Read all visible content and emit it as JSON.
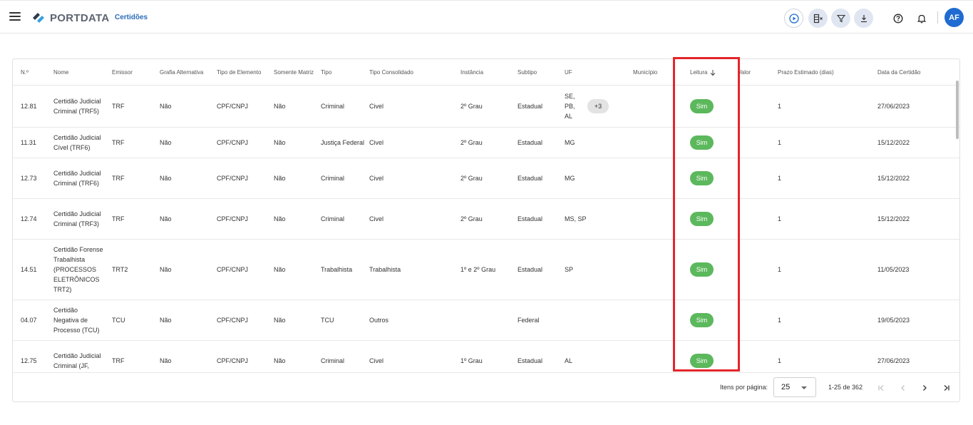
{
  "header": {
    "brand": "PORTDATA",
    "page_link": "Certidões",
    "avatar_initials": "AF",
    "brand_colors": {
      "primary": "#1f6bd1",
      "logo_dark": "#2b3a4a",
      "logo_light": "#3aa0e0"
    }
  },
  "toolbar_icons": [
    "play-circle-icon",
    "columns-clear-icon",
    "filter-icon",
    "download-icon",
    "help-icon",
    "bell-icon"
  ],
  "table": {
    "columns": [
      {
        "key": "num",
        "label": "N.º"
      },
      {
        "key": "nome",
        "label": "Nome"
      },
      {
        "key": "emissor",
        "label": "Emissor"
      },
      {
        "key": "grafia",
        "label": "Grafia Alternativa"
      },
      {
        "key": "tipo_elemento",
        "label": "Tipo de Elemento"
      },
      {
        "key": "somente_matriz",
        "label": "Somente Matriz"
      },
      {
        "key": "tipo",
        "label": "Tipo"
      },
      {
        "key": "tipo_consolidado",
        "label": "Tipo Consolidado"
      },
      {
        "key": "instancia",
        "label": "Instância"
      },
      {
        "key": "subtipo",
        "label": "Subtipo"
      },
      {
        "key": "uf",
        "label": "UF"
      },
      {
        "key": "municipio",
        "label": "Município"
      },
      {
        "key": "leitura",
        "label": "Leitura"
      },
      {
        "key": "valor",
        "label": "Valor"
      },
      {
        "key": "prazo",
        "label": "Prazo Estimado (dias)"
      },
      {
        "key": "data",
        "label": "Data da Certidão"
      }
    ],
    "sort": {
      "column": "Leitura",
      "direction": "desc"
    },
    "rows": [
      {
        "num": "12.81",
        "nome": "Certidão Judicial Criminal (TRF5)",
        "emissor": "TRF",
        "grafia": "Não",
        "tipo_elemento": "CPF/CNPJ",
        "somente_matriz": "Não",
        "tipo": "Criminal",
        "tipo_consolidado": "Civel",
        "instancia": "2º Grau",
        "subtipo": "Estadual",
        "uf": "SE, PB, AL",
        "uf_more": "+3",
        "municipio": "",
        "leitura": "Sim",
        "valor": "",
        "prazo": "1",
        "data": "27/06/2023"
      },
      {
        "num": "11.31",
        "nome": "Certidão Judicial Cível (TRF6)",
        "emissor": "TRF",
        "grafia": "Não",
        "tipo_elemento": "CPF/CNPJ",
        "somente_matriz": "Não",
        "tipo": "Justiça Federal",
        "tipo_consolidado": "Civel",
        "instancia": "2º Grau",
        "subtipo": "Estadual",
        "uf": "MG",
        "uf_more": "",
        "municipio": "",
        "leitura": "Sim",
        "valor": "",
        "prazo": "1",
        "data": "15/12/2022"
      },
      {
        "num": "12.73",
        "nome": "Certidão Judicial Criminal (TRF6)",
        "emissor": "TRF",
        "grafia": "Não",
        "tipo_elemento": "CPF/CNPJ",
        "somente_matriz": "Não",
        "tipo": "Criminal",
        "tipo_consolidado": "Civel",
        "instancia": "2º Grau",
        "subtipo": "Estadual",
        "uf": "MG",
        "uf_more": "",
        "municipio": "",
        "leitura": "Sim",
        "valor": "",
        "prazo": "1",
        "data": "15/12/2022"
      },
      {
        "num": "12.74",
        "nome": "Certidão Judicial Criminal (TRF3)",
        "emissor": "TRF",
        "grafia": "Não",
        "tipo_elemento": "CPF/CNPJ",
        "somente_matriz": "Não",
        "tipo": "Criminal",
        "tipo_consolidado": "Civel",
        "instancia": "2º Grau",
        "subtipo": "Estadual",
        "uf": "MS, SP",
        "uf_more": "",
        "municipio": "",
        "leitura": "Sim",
        "valor": "",
        "prazo": "1",
        "data": "15/12/2022"
      },
      {
        "num": "14.51",
        "nome": "Certidão Forense Trabalhista (PROCESSOS ELETRÔNICOS TRT2)",
        "emissor": "TRT2",
        "grafia": "Não",
        "tipo_elemento": "CPF/CNPJ",
        "somente_matriz": "Não",
        "tipo": "Trabalhista",
        "tipo_consolidado": "Trabalhista",
        "instancia": "1º e 2º Grau",
        "subtipo": "Estadual",
        "uf": "SP",
        "uf_more": "",
        "municipio": "",
        "leitura": "Sim",
        "valor": "",
        "prazo": "1",
        "data": "11/05/2023"
      },
      {
        "num": "04.07",
        "nome": "Certidão Negativa de Processo (TCU)",
        "emissor": "TCU",
        "grafia": "Não",
        "tipo_elemento": "CPF/CNPJ",
        "somente_matriz": "Não",
        "tipo": "TCU",
        "tipo_consolidado": "Outros",
        "instancia": "",
        "subtipo": "Federal",
        "uf": "",
        "uf_more": "",
        "municipio": "",
        "leitura": "Sim",
        "valor": "",
        "prazo": "1",
        "data": "19/05/2023"
      },
      {
        "num": "12.75",
        "nome": "Certidão Judicial Criminal (JF,",
        "emissor": "TRF",
        "grafia": "Não",
        "tipo_elemento": "CPF/CNPJ",
        "somente_matriz": "Não",
        "tipo": "Criminal",
        "tipo_consolidado": "Civel",
        "instancia": "1º Grau",
        "subtipo": "Estadual",
        "uf": "AL",
        "uf_more": "",
        "municipio": "",
        "leitura": "Sim",
        "valor": "",
        "prazo": "1",
        "data": "27/06/2023"
      }
    ]
  },
  "pagination": {
    "items_per_page_label": "Itens por página:",
    "items_per_page_value": "25",
    "range_label": "1-25 de 362"
  },
  "colors": {
    "pill_green": "#5cb85c",
    "highlight_red": "#e5252a",
    "link_blue": "#2b6cb8"
  }
}
